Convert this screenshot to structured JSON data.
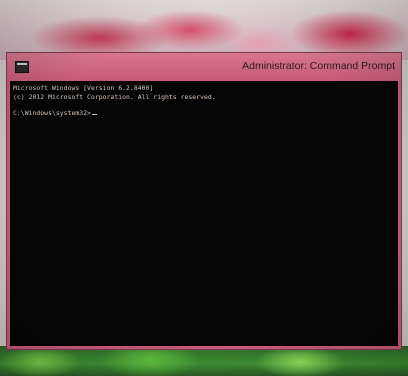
{
  "window": {
    "title": "Administrator: Command Prompt",
    "sysmenu_icon": "cmd-icon"
  },
  "console": {
    "lines": [
      "Microsoft Windows [Version 6.2.8400]",
      "(c) 2012 Microsoft Corporation. All rights reserved.",
      "C:\\Windows\\system32>"
    ]
  }
}
